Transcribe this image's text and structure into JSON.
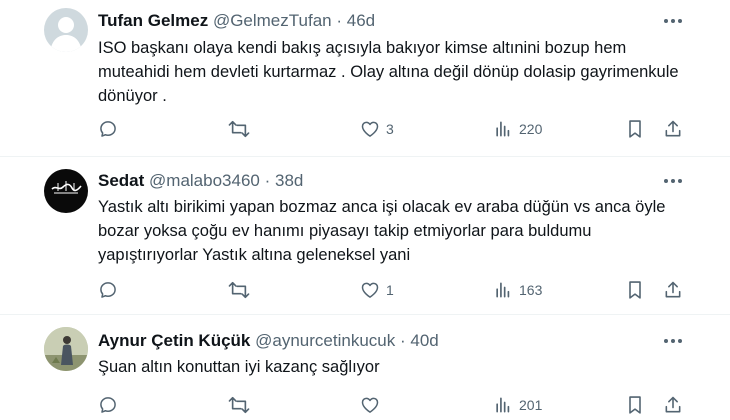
{
  "tweets": [
    {
      "name": "Tufan Gelmez",
      "handle": "@GelmezTufan",
      "separator": "·",
      "time": "46d",
      "text": "ISO başkanı olaya kendi bakış açısıyla bakıyor kimse altınini bozup hem muteahidi hem devleti kurtarmaz . Olay altına değil dönüp dolasip gayrimenkule dönüyor .",
      "replies": "",
      "retweets": "",
      "likes": "3",
      "views": "220",
      "avatar": "default-avatar"
    },
    {
      "name": "Sedat",
      "handle": "@malabo3460",
      "separator": "·",
      "time": "38d",
      "text": "Yastık altı birikimi yapan bozmaz anca işi olacak ev araba düğün vs anca öyle bozar yoksa çoğu ev hanımı piyasayı takip etmiyorlar para buldumu yapıştırıyorlar Yastık altına geleneksel yani",
      "replies": "",
      "retweets": "",
      "likes": "1",
      "views": "163",
      "avatar": "calligraphy-avatar",
      "avatar_text": "Estağfirullah"
    },
    {
      "name": "Aynur Çetin Küçük",
      "handle": "@aynurcetinkucuk",
      "separator": "·",
      "time": "40d",
      "text": "Şuan altın konuttan iyi kazanç sağlıyor",
      "replies": "",
      "retweets": "",
      "likes": "",
      "views": "201",
      "avatar": "photo-avatar"
    }
  ],
  "colors": {
    "text": "#0f1419",
    "muted": "#536471",
    "divider": "#eff3f4"
  }
}
